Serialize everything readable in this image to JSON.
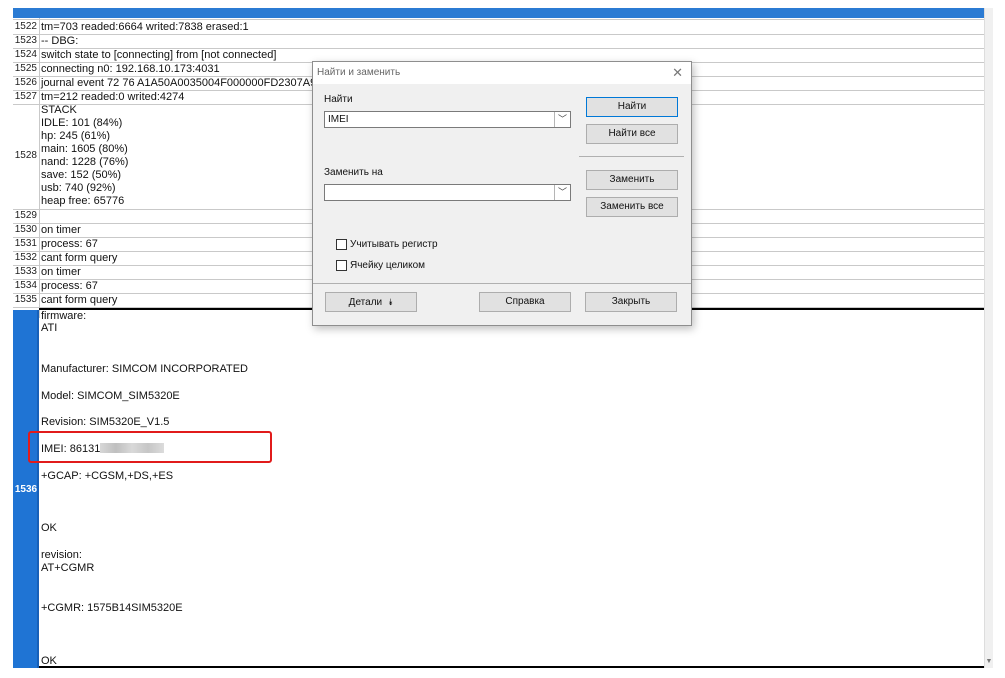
{
  "rows": [
    {
      "num": "1522",
      "text": "tm=703 readed:6664 writed:7838 erased:1"
    },
    {
      "num": "1523",
      "text": "-- DBG:"
    },
    {
      "num": "1524",
      "text": "switch state to [connecting] from [not connected]"
    },
    {
      "num": "1525",
      "text": "connecting n0: 192.168.10.173:4031"
    },
    {
      "num": "1526",
      "text": "journal event 72 76 A1A50A0035004F000000FD2307A9A"
    },
    {
      "num": "1527",
      "text": "tm=212 readed:0 writed:4274"
    },
    {
      "num": "1528",
      "lines": [
        "STACK",
        "IDLE: 101 (84%)",
        "hp: 245 (61%)",
        "main: 1605 (80%)",
        "nand: 1228 (76%)",
        "save: 152 (50%)",
        "usb: 740 (92%)",
        "heap free: 65776"
      ]
    },
    {
      "num": "1529",
      "text": ""
    },
    {
      "num": "1530",
      "text": "on timer"
    },
    {
      "num": "1531",
      "text": "process: 67"
    },
    {
      "num": "1532",
      "text": "cant form query"
    },
    {
      "num": "1533",
      "text": "on timer"
    },
    {
      "num": "1534",
      "text": "process: 67"
    },
    {
      "num": "1535",
      "text": "cant form query"
    }
  ],
  "selected_row": {
    "num": "1536",
    "lines": [
      "firmware:",
      "ATI",
      "Manufacturer: SIMCOM INCORPORATED",
      "Model: SIMCOM_SIM5320E",
      "Revision: SIM5320E_V1.5",
      "IMEI: 86131",
      "+GCAP: +CGSM,+DS,+ES",
      "OK",
      "revision:",
      "AT+CGMR",
      "+CGMR: 1575B14SIM5320E",
      "OK"
    ]
  },
  "dialog": {
    "title": "Найти и заменить",
    "find_label": "Найти",
    "find_value": "IMEI",
    "replace_label": "Заменить на",
    "replace_value": "",
    "match_case_label": "Учитывать регистр",
    "whole_cell_label": "Ячейку целиком",
    "btn_find": "Найти",
    "btn_find_all": "Найти все",
    "btn_replace": "Заменить",
    "btn_replace_all": "Заменить все",
    "btn_details": "Детали",
    "btn_help": "Справка",
    "btn_close": "Закрыть"
  },
  "colors": {
    "accent": "#2b7bd3",
    "selected_row": "#1f74d4",
    "highlight_box": "#e11b1b"
  },
  "icons": {
    "close": "close-icon",
    "dropdown": "chevron-down-icon",
    "details": "double-chevron-down-icon"
  }
}
